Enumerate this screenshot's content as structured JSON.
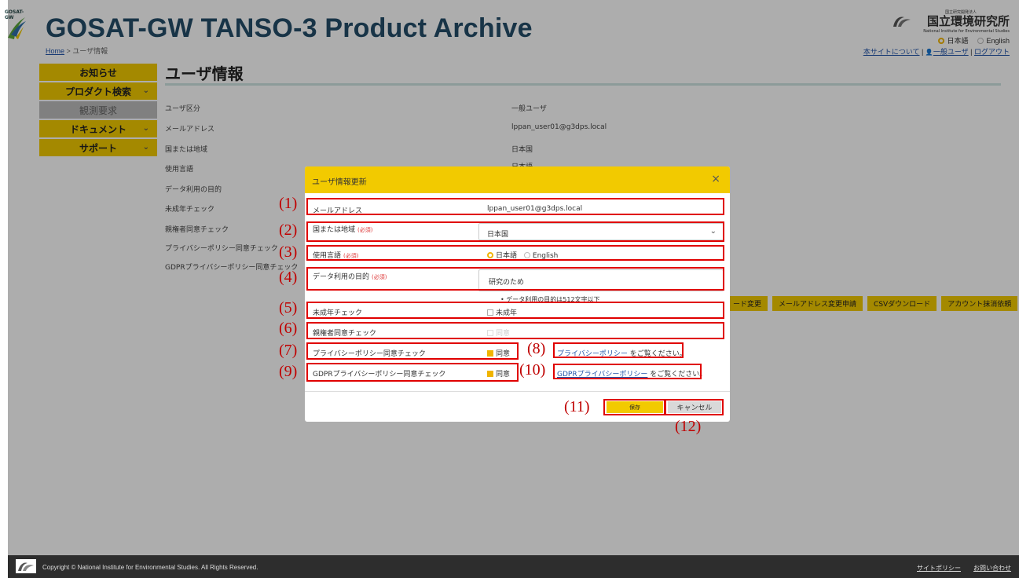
{
  "header": {
    "logo_small": "GOSAT-GW",
    "title": "GOSAT-GW TANSO-3 Product Archive",
    "breadcrumb_home": "Home",
    "breadcrumb_sep": " > ",
    "breadcrumb_current": "ユーザ情報",
    "org_tiny": "国立研究開発法人",
    "org_name": "国立環境研究所",
    "org_sub": "National Institute for Environmental Studies",
    "lang_ja": "日本語",
    "lang_en": "English",
    "link_about": "本サイトについて",
    "sep": " | ",
    "user_icon": "👤",
    "link_user": "一般ユーザ",
    "link_logout": "ログアウト"
  },
  "sidebar": {
    "items": [
      {
        "label": "お知らせ",
        "chevron": ""
      },
      {
        "label": "プロダクト検索",
        "chevron": "⌄"
      },
      {
        "label": "観測要求",
        "chevron": ""
      },
      {
        "label": "ドキュメント",
        "chevron": "⌄"
      },
      {
        "label": "サポート",
        "chevron": "⌄"
      }
    ]
  },
  "main": {
    "page_title": "ユーザ情報",
    "fields": [
      {
        "label": "ユーザ区分",
        "value": "一般ユーザ"
      },
      {
        "label": "メールアドレス",
        "value": "lppan_user01@g3dps.local"
      },
      {
        "label": "国または地域",
        "value": "日本国"
      },
      {
        "label": "使用言語",
        "value": "日本語"
      },
      {
        "label": "データ利用の目的",
        "value": ""
      },
      {
        "label": "未成年チェック",
        "value": ""
      },
      {
        "label": "親権者同意チェック",
        "value": ""
      },
      {
        "label": "プライバシーポリシー同意チェック",
        "value": ""
      },
      {
        "label": "GDPRプライバシーポリシー同意チェック",
        "value": ""
      }
    ],
    "actions": [
      "ード変更",
      "メールアドレス変更申請",
      "CSVダウンロード",
      "アカウント抹消依頼"
    ]
  },
  "modal": {
    "title": "ユーザ情報更新",
    "close": "×",
    "required": "(必須)",
    "email_label": "メールアドレス",
    "email_value": "lppan_user01@g3dps.local",
    "country_label": "国または地域",
    "country_value": "日本国",
    "chevron": "⌄",
    "language_label": "使用言語",
    "language_ja": "日本語",
    "language_en": "English",
    "purpose_label": "データ利用の目的",
    "purpose_value": "研究のため",
    "purpose_note": "•  データ利用の目的は512文字以下",
    "minor_label": "未成年チェック",
    "minor_option": "未成年",
    "parent_label": "親権者同意チェック",
    "parent_option": "同意",
    "privacy_label": "プライバシーポリシー同意チェック",
    "privacy_option": "同意",
    "privacy_link": "プライバシーポリシー",
    "privacy_suffix": " をご覧ください。",
    "gdpr_label": "GDPRプライバシーポリシー同意チェック",
    "gdpr_option": "同意",
    "gdpr_link": "GDPRプライバシーポリシー",
    "gdpr_suffix": " をご覧ください。",
    "save": "保存",
    "cancel": "キャンセル"
  },
  "annotations": [
    "(1)",
    "(2)",
    "(3)",
    "(4)",
    "(5)",
    "(6)",
    "(7)",
    "(8)",
    "(9)",
    "(10)",
    "(11)",
    "(12)"
  ],
  "footer": {
    "copyright": "Copyright © National Institute for Environmental Studies. All Rights Reserved.",
    "link_policy": "サイトポリシー",
    "link_contact": "お問い合わせ"
  },
  "colors": {
    "accent": "#f2ca00",
    "title": "#244d69",
    "annotation": "#e00000"
  }
}
